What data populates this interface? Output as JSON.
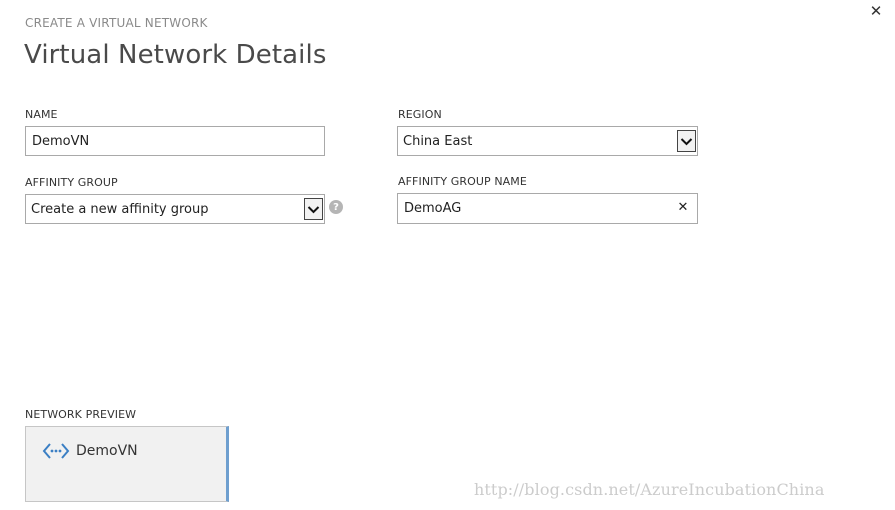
{
  "header": {
    "step_label": "CREATE A VIRTUAL NETWORK",
    "title": "Virtual Network Details",
    "close_icon": "close-icon"
  },
  "form": {
    "name": {
      "label": "NAME",
      "value": "DemoVN"
    },
    "region": {
      "label": "REGION",
      "selected": "China East"
    },
    "affinity_group": {
      "label": "AFFINITY GROUP",
      "selected": "Create a new affinity group",
      "help_icon": "help-icon"
    },
    "affinity_group_name": {
      "label": "AFFINITY GROUP NAME",
      "value": "DemoAG",
      "clear_icon": "clear-icon"
    }
  },
  "preview": {
    "label": "NETWORK PREVIEW",
    "network_name": "DemoVN",
    "icon": "virtual-network-icon",
    "accent_color": "#6f9fcf"
  },
  "watermark": {
    "text": "http://blog.csdn.net/AzureIncubationChina"
  }
}
